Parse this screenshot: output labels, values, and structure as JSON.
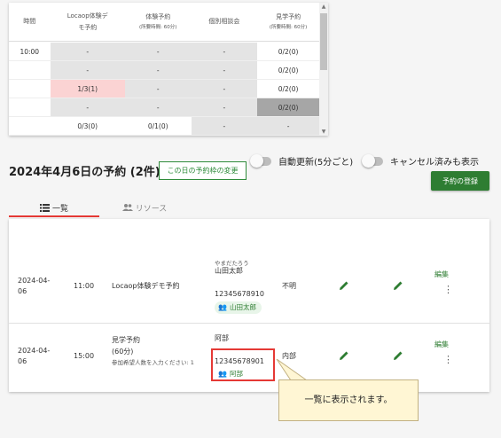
{
  "table": {
    "headers": [
      {
        "line1": "時間",
        "line2": ""
      },
      {
        "line1": "Locaop体験デ",
        "line2": "モ予約"
      },
      {
        "line1": "体験予約",
        "line2": "(所要時間: 60分)"
      },
      {
        "line1": "個別相談会",
        "line2": ""
      },
      {
        "line1": "見学予約",
        "line2": "(所要時間: 60分)"
      }
    ],
    "rows": [
      {
        "time": "10:00",
        "c1": "-",
        "c2": "-",
        "c3": "-",
        "c4": "0/2(0)"
      },
      {
        "time": "",
        "c1": "-",
        "c2": "-",
        "c3": "-",
        "c4": "0/2(0)"
      },
      {
        "time": "",
        "c1": "1/3(1)",
        "c2": "-",
        "c3": "-",
        "c4": "0/2(0)"
      },
      {
        "time": "",
        "c1": "-",
        "c2": "-",
        "c3": "-",
        "c4": "0/2(0)"
      },
      {
        "time": "",
        "c1": "0/3(0)",
        "c2": "0/1(0)",
        "c3": "-",
        "c4": "-"
      }
    ]
  },
  "day": {
    "title": "2024年4月6日の予約 (2件)",
    "change_button": "この日の予約枠の変更",
    "toggle_auto": "自動更新(5分ごと)",
    "toggle_cancel": "キャンセル済みも表示",
    "register_button": "予約の登録"
  },
  "tabs": {
    "list": "一覧",
    "resource": "リソース"
  },
  "reservations": [
    {
      "date": "2024-04-06",
      "time": "11:00",
      "course": "Locaop体験デモ予約",
      "course_sub": "",
      "kana": "やまだたろう",
      "name": "山田太郎",
      "phone": "12345678910",
      "chip": "山田太郎",
      "status": "不明",
      "edit_label": "編集"
    },
    {
      "date": "2024-04-06",
      "time": "15:00",
      "course": "見学予約",
      "course_sub": "(60分)",
      "course_note": "参加希望人数を入力ください: 1",
      "kana": "",
      "name": "阿部",
      "phone": "12345678901",
      "chip": "阿部",
      "status": "内部",
      "edit_label": "編集"
    }
  ],
  "callout": {
    "text": "一覧に表示されます。"
  },
  "colors": {
    "accent_green": "#2e7d32",
    "highlight_red": "#e53935",
    "callout_bg": "#fff6d4"
  }
}
